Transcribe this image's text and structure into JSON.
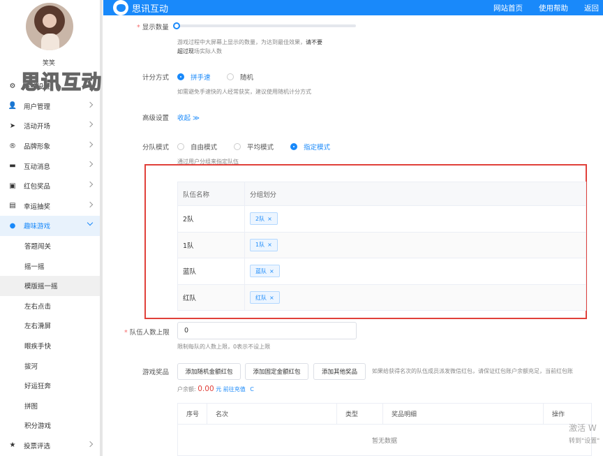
{
  "sidebar": {
    "username": "笑笑",
    "watermark": "思讯互动",
    "items": [
      {
        "label": "系统设置",
        "icon": "gear-icon"
      },
      {
        "label": "用户管理",
        "icon": "user-icon"
      },
      {
        "label": "活动开场",
        "icon": "paper-plane-icon"
      },
      {
        "label": "品牌形象",
        "icon": "registered-icon"
      },
      {
        "label": "互动消息",
        "icon": "message-icon"
      },
      {
        "label": "红包奖品",
        "icon": "gift-icon"
      },
      {
        "label": "幸运抽奖",
        "icon": "lottery-icon"
      },
      {
        "label": "趣味游戏",
        "icon": "game-icon"
      }
    ],
    "subitems": [
      "答题闯关",
      "摇一摇",
      "模版摇一摇",
      "左右点击",
      "左右滑屏",
      "眼疾手快",
      "拔河",
      "好运狂奔",
      "拼图",
      "积分游戏"
    ],
    "last_item": {
      "label": "投票评选",
      "icon": "star-icon"
    }
  },
  "header": {
    "brand": "思讯互动",
    "nav": [
      "网站首页",
      "使用帮助",
      "返回"
    ]
  },
  "form": {
    "display_count": {
      "label": "显示数量",
      "help1": "游戏过程中大屏幕上显示的数量，为达到最佳效果，",
      "help_bold": "请不要超过现",
      "help2": "场实际人数"
    },
    "scoring": {
      "label": "计分方式",
      "options": [
        "拼手速",
        "随机"
      ],
      "help": "如需避免手速快的人经常获奖，建议使用随机计分方式"
    },
    "advanced": {
      "label": "高级设置",
      "toggle": "收起 ≫"
    },
    "team_mode": {
      "label": "分队模式",
      "options": [
        "自由模式",
        "平均模式",
        "指定模式"
      ],
      "help": "通过用户分组来指定队伍"
    },
    "team_table": {
      "headers": [
        "队伍名称",
        "分组划分"
      ],
      "rows": [
        {
          "team": "2队",
          "tag": "2队"
        },
        {
          "team": "1队",
          "tag": "1队"
        },
        {
          "team": "蓝队",
          "tag": "蓝队"
        },
        {
          "team": "红队",
          "tag": "红队"
        }
      ],
      "tag_close": "×"
    },
    "team_limit": {
      "label": "队伍人数上限",
      "value": "0",
      "help": "限制每队的人数上限，0表示不设上限"
    },
    "prizes": {
      "label": "游戏奖品",
      "buttons": [
        "添加随机金额红包",
        "添加固定金额红包",
        "添加其他奖品"
      ],
      "note": "如果给获得名次的队伍成员派发微信红包，请保证红包账户余额充足，当前红包账",
      "balance_label": "户余额:",
      "balance": "0.00",
      "unit": "元",
      "recharge": "前往充值",
      "refresh": "C",
      "table_headers": [
        "序号",
        "名次",
        "类型",
        "奖品明细",
        "操作"
      ],
      "empty": "暂无数据"
    }
  },
  "system_notice": {
    "line1": "激活 W",
    "line2": "转到\"设置\""
  }
}
